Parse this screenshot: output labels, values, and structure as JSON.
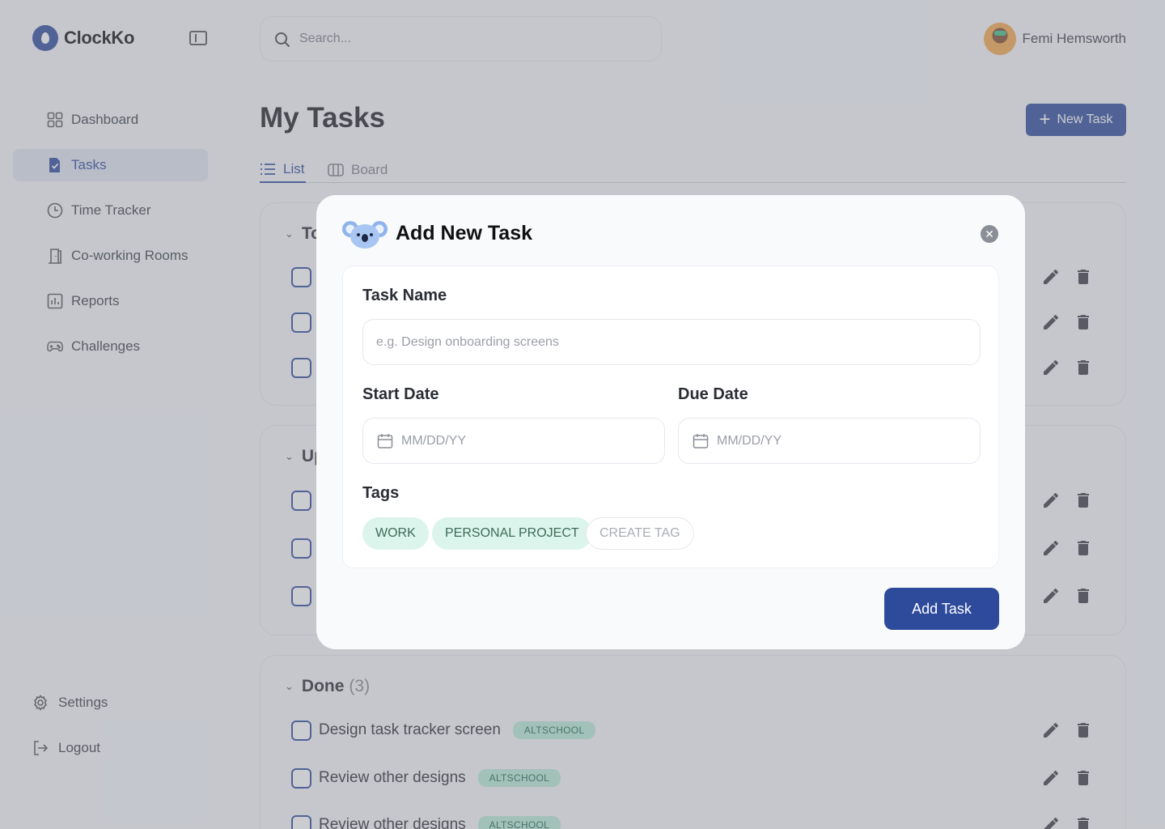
{
  "app": {
    "name": "ClockKo"
  },
  "sidebar": {
    "items": [
      {
        "label": "Dashboard",
        "icon": "grid-icon"
      },
      {
        "label": "Tasks",
        "icon": "task-file-icon",
        "active": true
      },
      {
        "label": "Time Tracker",
        "icon": "clock-icon"
      },
      {
        "label": "Co-working Rooms",
        "icon": "door-icon"
      },
      {
        "label": "Reports",
        "icon": "bar-chart-icon"
      },
      {
        "label": "Challenges",
        "icon": "gamepad-icon"
      }
    ],
    "bottom": [
      {
        "label": "Settings",
        "icon": "gear-icon"
      },
      {
        "label": "Logout",
        "icon": "logout-icon"
      }
    ]
  },
  "header": {
    "search_placeholder": "Search...",
    "user_name": "Femi Hemsworth"
  },
  "main": {
    "title": "My Tasks",
    "new_task_label": "New Task",
    "tabs": [
      {
        "label": "List",
        "active": true
      },
      {
        "label": "Board"
      }
    ],
    "sections": [
      {
        "title": "To"
      },
      {
        "title": "Up"
      },
      {
        "title": "Done",
        "count": "(3)",
        "tasks": [
          {
            "title": "Design task tracker screen",
            "tag": "ALTSCHOOL"
          },
          {
            "title": "Review other designs",
            "tag": "ALTSCHOOL"
          },
          {
            "title": "Review other designs",
            "tag": "ALTSCHOOL"
          }
        ]
      }
    ]
  },
  "modal": {
    "title": "Add New Task",
    "task_name_label": "Task Name",
    "task_name_placeholder": "e.g. Design onboarding screens",
    "start_date_label": "Start Date",
    "start_date_placeholder": "MM/DD/YY",
    "due_date_label": "Due Date",
    "due_date_placeholder": "MM/DD/YY",
    "tags_label": "Tags",
    "tags": [
      "WORK",
      "PERSONAL PROJECT"
    ],
    "create_tag_label": "CREATE TAG",
    "submit_label": "Add Task"
  },
  "colors": {
    "brand": "#2d4a9b",
    "tag_bg": "#b8ecd7",
    "chip_bg": "#dcf5ec",
    "overlay": "rgba(130,134,143,0.42)"
  }
}
